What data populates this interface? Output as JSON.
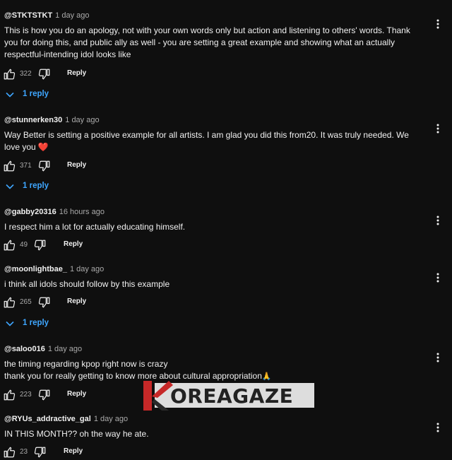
{
  "comments": [
    {
      "handle": "@STKTSTKT",
      "time": "1 day ago",
      "lines": [
        "This is how you do an apology, not with your own words only but action and listening to others' words. Thank",
        "you for doing this, and public ally as well - you are setting a great example and showing what an actually",
        "respectful-intending idol looks like"
      ],
      "likes": "322",
      "reply_label": "Reply",
      "replies_label": "1 reply"
    },
    {
      "handle": "@stunnerken30",
      "time": "1 day ago",
      "lines": [
        "Way Better is setting a positive example for all artists. I am glad you did this from20. It was truly needed. We",
        "love you"
      ],
      "emoji": "❤️",
      "likes": "371",
      "reply_label": "Reply",
      "replies_label": "1 reply"
    },
    {
      "handle": "@gabby20316",
      "time": "16 hours ago",
      "lines": [
        "I respect him a lot for actually educating himself."
      ],
      "likes": "49",
      "reply_label": "Reply"
    },
    {
      "handle": "@moonlightbae_",
      "time": "1 day ago",
      "lines": [
        "i think all idols should follow by this example"
      ],
      "likes": "265",
      "reply_label": "Reply",
      "replies_label": "1 reply"
    },
    {
      "handle": "@saloo016",
      "time": "1 day ago",
      "lines": [
        "the timing regarding kpop right now is crazy",
        "thank you for really getting to know more about cultural appropriation"
      ],
      "emoji": "🙏",
      "likes": "223",
      "reply_label": "Reply"
    },
    {
      "handle": "@RYUs_addractive_gal",
      "time": "1 day ago",
      "lines": [
        "IN THIS MONTH?? oh the way he ate."
      ],
      "likes": "23",
      "reply_label": "Reply"
    }
  ],
  "watermark": {
    "text": "OREAGAZE",
    "letter": "K"
  },
  "colors": {
    "background": "#0f0f0f",
    "text": "#f1f1f1",
    "meta": "#aaaaaa",
    "link": "#3ea6ff",
    "heart": "#e53935",
    "watermark_red": "#c62828"
  },
  "icons": {
    "like": "thumbs-up-icon",
    "dislike": "thumbs-down-icon",
    "expand": "chevron-down-icon",
    "menu": "more-vert-icon"
  }
}
